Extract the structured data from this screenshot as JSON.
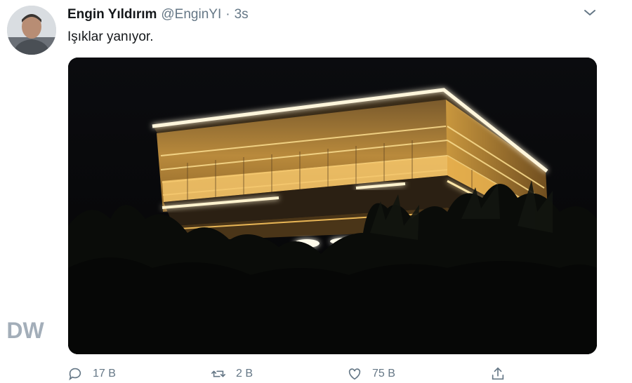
{
  "tweet": {
    "author": {
      "display_name": "Engin Yıldırım",
      "handle": "@EnginYI",
      "separator": "·",
      "time": "3s"
    },
    "text": "Işıklar yanıyor.",
    "media": {
      "subject": "illuminated-building-at-night"
    }
  },
  "actions": {
    "reply": {
      "icon": "reply-icon",
      "count": "17 B"
    },
    "retweet": {
      "icon": "retweet-icon",
      "count": "2 B"
    },
    "like": {
      "icon": "heart-icon",
      "count": "75 B"
    },
    "share": {
      "icon": "share-icon",
      "count": ""
    }
  },
  "watermark": {
    "text": "DW"
  },
  "colors": {
    "text_primary": "#14171a",
    "text_secondary": "#657786",
    "building_light": "#f3c46a"
  }
}
